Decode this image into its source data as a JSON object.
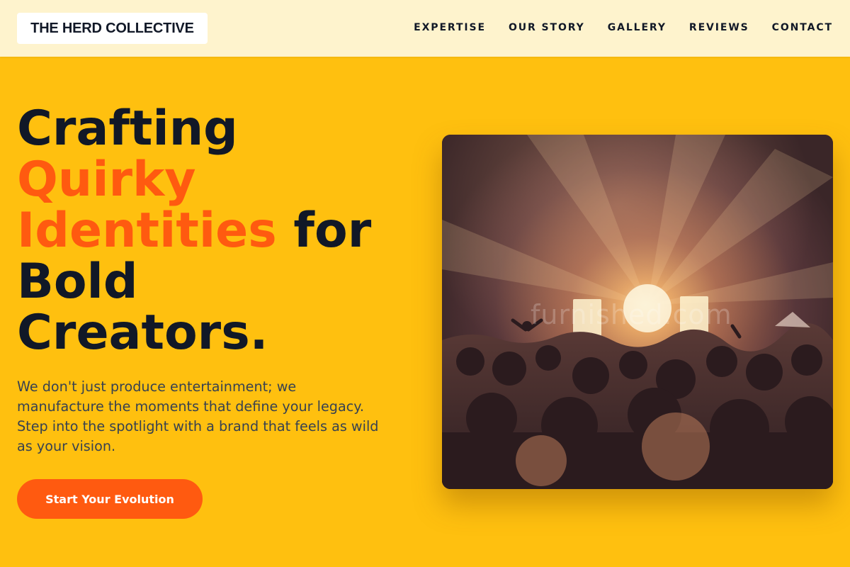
{
  "brand": {
    "name": "THE HERD COLLECTIVE"
  },
  "nav": {
    "items": [
      {
        "label": "EXPERTISE"
      },
      {
        "label": "OUR STORY"
      },
      {
        "label": "GALLERY"
      },
      {
        "label": "REVIEWS"
      },
      {
        "label": "CONTACT"
      }
    ]
  },
  "hero": {
    "headline": {
      "part1": "Crafting",
      "accent1": "Quirky",
      "accent2": "Identities",
      "part2": " for",
      "part3": "Bold",
      "part4": "Creators."
    },
    "description": "We don't just produce entertainment; we manufacture the moments that define your legacy. Step into the spotlight with a brand that feels as wild as your vision.",
    "cta_label": "Start Your Evolution",
    "image_watermark": "furnished.com"
  },
  "colors": {
    "background": "#FFC00F",
    "header_bg": "#FEF3CD",
    "accent": "#FF5A10",
    "text_dark": "#111827",
    "text_body": "#374151"
  }
}
